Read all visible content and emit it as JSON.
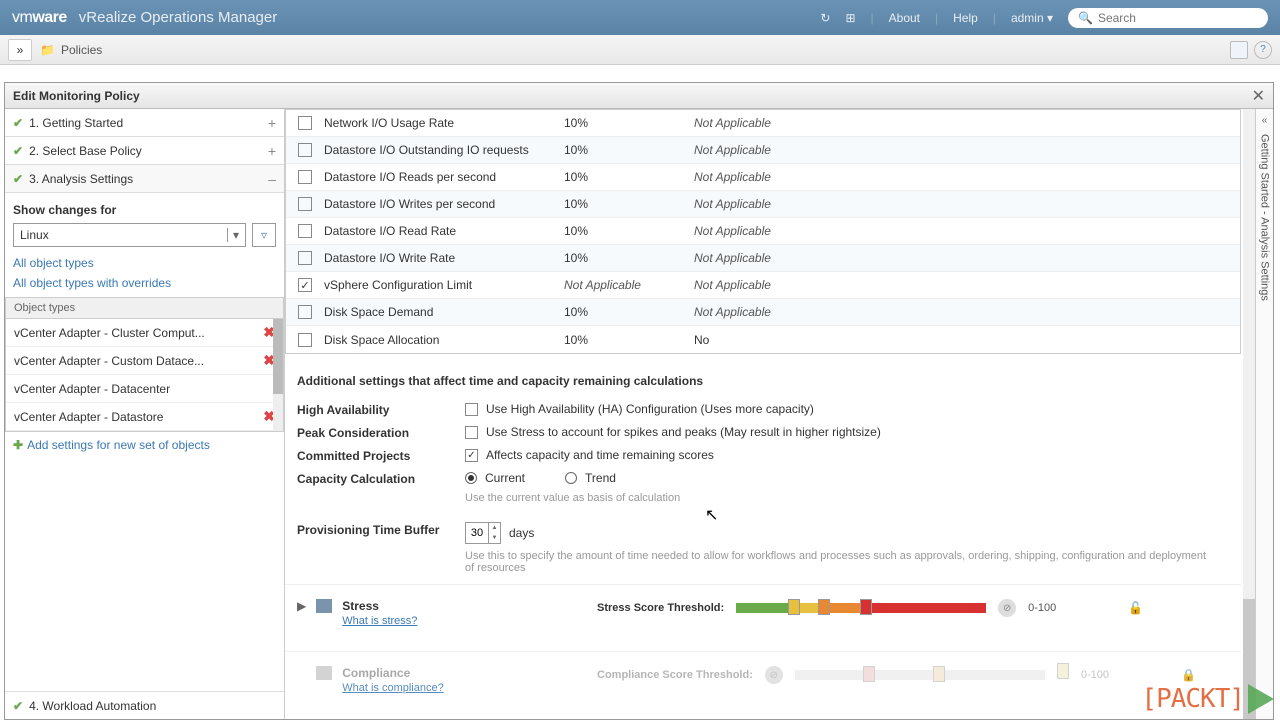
{
  "header": {
    "logo": "vmware",
    "product": "vRealize Operations Manager",
    "about": "About",
    "help": "Help",
    "user": "admin",
    "search_placeholder": "Search"
  },
  "breadcrumb": {
    "label": "Policies"
  },
  "dialog": {
    "title": "Edit Monitoring Policy",
    "steps": [
      {
        "label": "1. Getting Started",
        "toggle": "+"
      },
      {
        "label": "2. Select Base Policy",
        "toggle": "+"
      },
      {
        "label": "3. Analysis Settings",
        "toggle": "–"
      }
    ],
    "show_changes_label": "Show changes for",
    "filter_value": "Linux",
    "link_all": "All object types",
    "link_overrides": "All object types with overrides",
    "object_types_hdr": "Object types",
    "objects": [
      "vCenter Adapter - Cluster Comput...",
      "vCenter Adapter - Custom Datace...",
      "vCenter Adapter - Datacenter",
      "vCenter Adapter - Datastore"
    ],
    "add_link": "Add settings for new set of objects",
    "step4": "4. Workload Automation"
  },
  "table": {
    "rows": [
      {
        "name": "Network I/O Usage Rate",
        "val": "10%",
        "app": "Not Applicable",
        "checked": false
      },
      {
        "name": "Datastore I/O Outstanding IO requests",
        "val": "10%",
        "app": "Not Applicable",
        "checked": false
      },
      {
        "name": "Datastore I/O Reads per second",
        "val": "10%",
        "app": "Not Applicable",
        "checked": false
      },
      {
        "name": "Datastore I/O Writes per second",
        "val": "10%",
        "app": "Not Applicable",
        "checked": false
      },
      {
        "name": "Datastore I/O Read Rate",
        "val": "10%",
        "app": "Not Applicable",
        "checked": false
      },
      {
        "name": "Datastore I/O Write Rate",
        "val": "10%",
        "app": "Not Applicable",
        "checked": false
      },
      {
        "name": "vSphere Configuration Limit",
        "val": "Not Applicable",
        "app": "Not Applicable",
        "checked": true,
        "valNA": true
      },
      {
        "name": "Disk Space Demand",
        "val": "10%",
        "app": "Not Applicable",
        "checked": false
      },
      {
        "name": "Disk Space Allocation",
        "val": "10%",
        "app": "No",
        "checked": false,
        "appPlain": true
      }
    ]
  },
  "additional": {
    "header": "Additional settings that affect time and capacity remaining calculations",
    "ha_label": "High Availability",
    "ha_text": "Use High Availability (HA) Configuration (Uses more capacity)",
    "peak_label": "Peak Consideration",
    "peak_text": "Use Stress to account for spikes and peaks (May result in higher rightsize)",
    "proj_label": "Committed Projects",
    "proj_text": "Affects capacity and time remaining scores",
    "calc_label": "Capacity Calculation",
    "calc_current": "Current",
    "calc_trend": "Trend",
    "calc_help": "Use the current value as basis of calculation",
    "prov_label": "Provisioning Time Buffer",
    "prov_value": "30",
    "prov_unit": "days",
    "prov_help": "Use this to specify the amount of time needed to allow for workflows and processes such as approvals, ordering, shipping, configuration and deployment of resources"
  },
  "stress": {
    "title": "Stress",
    "link": "What is stress?",
    "thresh_label": "Stress Score Threshold:",
    "range": "0-100"
  },
  "compliance": {
    "title": "Compliance",
    "link": "What is compliance?",
    "thresh_label": "Compliance Score Threshold:",
    "range": "0-100"
  },
  "rail": {
    "text": "Getting Started - Analysis Settings"
  }
}
